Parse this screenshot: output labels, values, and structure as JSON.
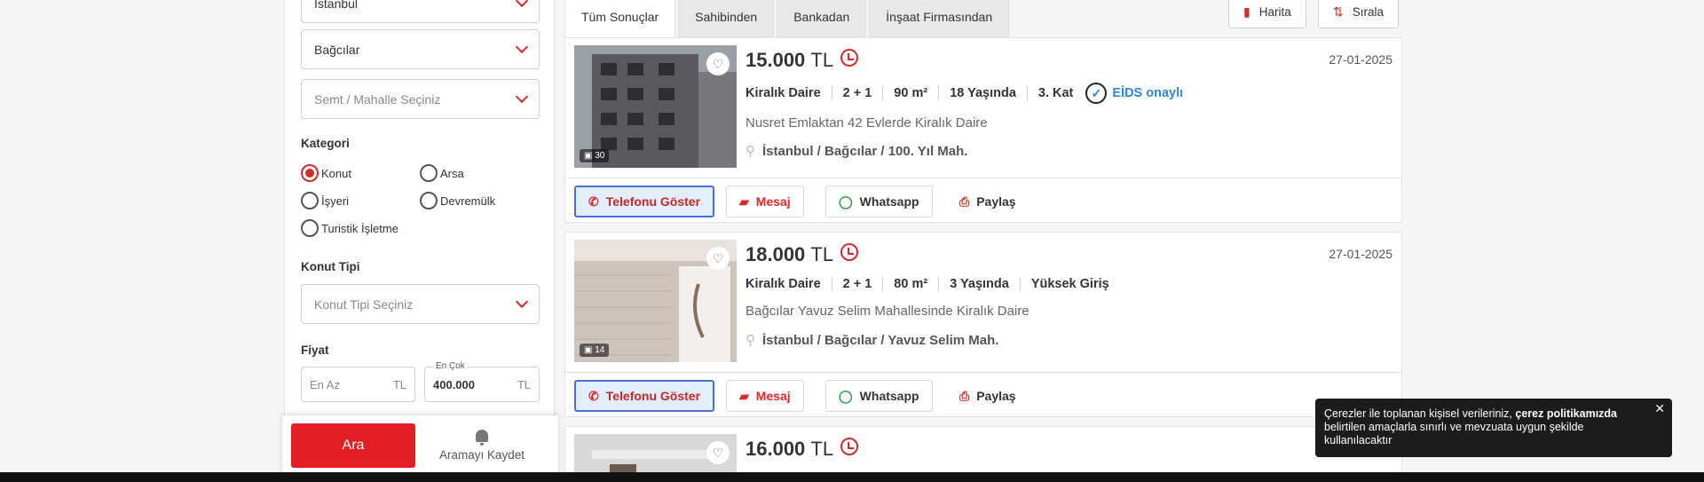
{
  "filters": {
    "city": {
      "value": "İstanbul"
    },
    "district": {
      "value": "Bağcılar"
    },
    "neighborhood": {
      "placeholder": "Semt / Mahalle Seçiniz"
    },
    "category_label": "Kategori",
    "categories": [
      {
        "label": "Konut",
        "selected": true
      },
      {
        "label": "Arsa",
        "selected": false
      },
      {
        "label": "İşyeri",
        "selected": false
      },
      {
        "label": "Devremülk",
        "selected": false
      },
      {
        "label": "Turistik İşletme",
        "selected": false
      }
    ],
    "housing_type_label": "Konut Tipi",
    "housing_type": {
      "placeholder": "Konut Tipi Seçiniz"
    },
    "price_label": "Fiyat",
    "price_min": {
      "placeholder": "En Az",
      "unit": "TL"
    },
    "price_max": {
      "float_label": "En Çok",
      "value": "400.000",
      "unit": "TL"
    }
  },
  "search_button": "Ara",
  "save_search_button": "Aramayı Kaydet",
  "tabs": [
    {
      "label": "Tüm Sonuçlar",
      "active": true
    },
    {
      "label": "Sahibinden",
      "active": false
    },
    {
      "label": "Bankadan",
      "active": false
    },
    {
      "label": "İnşaat Firmasından",
      "active": false
    }
  ],
  "toolbar": {
    "map_label": "Harita",
    "sort_label": "Sırala"
  },
  "listings": [
    {
      "price": "15.000",
      "currency": "TL",
      "date": "27-01-2025",
      "features": [
        "Kiralık Daire",
        "2 + 1",
        "90 m²",
        "18 Yaşında",
        "3. Kat"
      ],
      "eids": "EİDS onaylı",
      "title": "Nusret Emlaktan 42 Evlerde Kiralık Daire",
      "location": "İstanbul / Bağcılar / 100. Yıl Mah.",
      "photo_count": "30",
      "photo_color": "#5a5a5e"
    },
    {
      "price": "18.000",
      "currency": "TL",
      "date": "27-01-2025",
      "features": [
        "Kiralık Daire",
        "2 + 1",
        "80 m²",
        "3 Yaşında",
        "Yüksek Giriş"
      ],
      "title": "Bağcılar Yavuz Selim Mahallesinde Kiralık Daire",
      "location": "İstanbul / Bağcılar / Yavuz Selim Mah.",
      "photo_count": "14",
      "photo_color": "#cfc4bd"
    },
    {
      "price": "16.000",
      "currency": "TL",
      "photo_color": "#d8d8d8"
    }
  ],
  "actions": {
    "phone": "Telefonu Göster",
    "message": "Mesaj",
    "whatsapp": "Whatsapp",
    "share": "Paylaş"
  },
  "cookie": {
    "text_before": "Çerezler ile toplanan kişisel verileriniz, ",
    "text_bold": "çerez politikamızda",
    "text_after": " belirtilen amaçlarla sınırlı ve mevzuata uygun şekilde kullanılacaktır"
  }
}
